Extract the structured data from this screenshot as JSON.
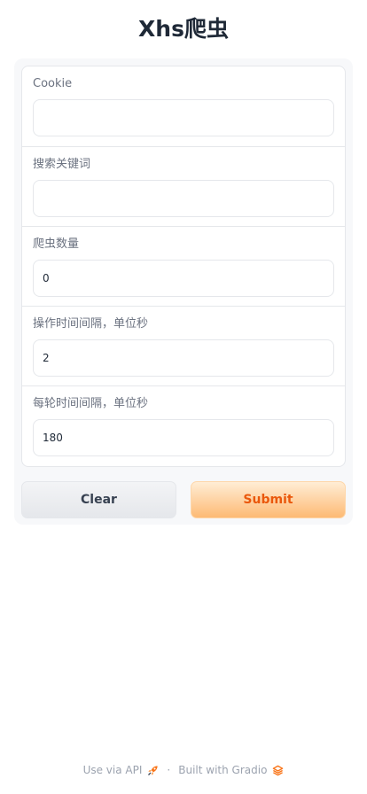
{
  "app": {
    "title": "Xhs爬虫"
  },
  "form": {
    "fields": [
      {
        "label": "Cookie",
        "value": "",
        "placeholder": ""
      },
      {
        "label": "搜索关键词",
        "value": "",
        "placeholder": ""
      },
      {
        "label": "爬虫数量",
        "value": "0",
        "placeholder": ""
      },
      {
        "label": "操作时间间隔，单位秒",
        "value": "2",
        "placeholder": ""
      },
      {
        "label": "每轮时间间隔，单位秒",
        "value": "180",
        "placeholder": ""
      }
    ]
  },
  "buttons": {
    "clear_label": "Clear",
    "submit_label": "Submit"
  },
  "footer": {
    "api_label": "Use via API",
    "separator": "·",
    "built_label": "Built with Gradio",
    "icons": [
      "rocket-icon",
      "gradio-logo-icon"
    ]
  },
  "colors": {
    "accent": "#ea580c",
    "submit_gradient_top": "#ffedd5",
    "submit_gradient_bottom": "#fdba74"
  }
}
